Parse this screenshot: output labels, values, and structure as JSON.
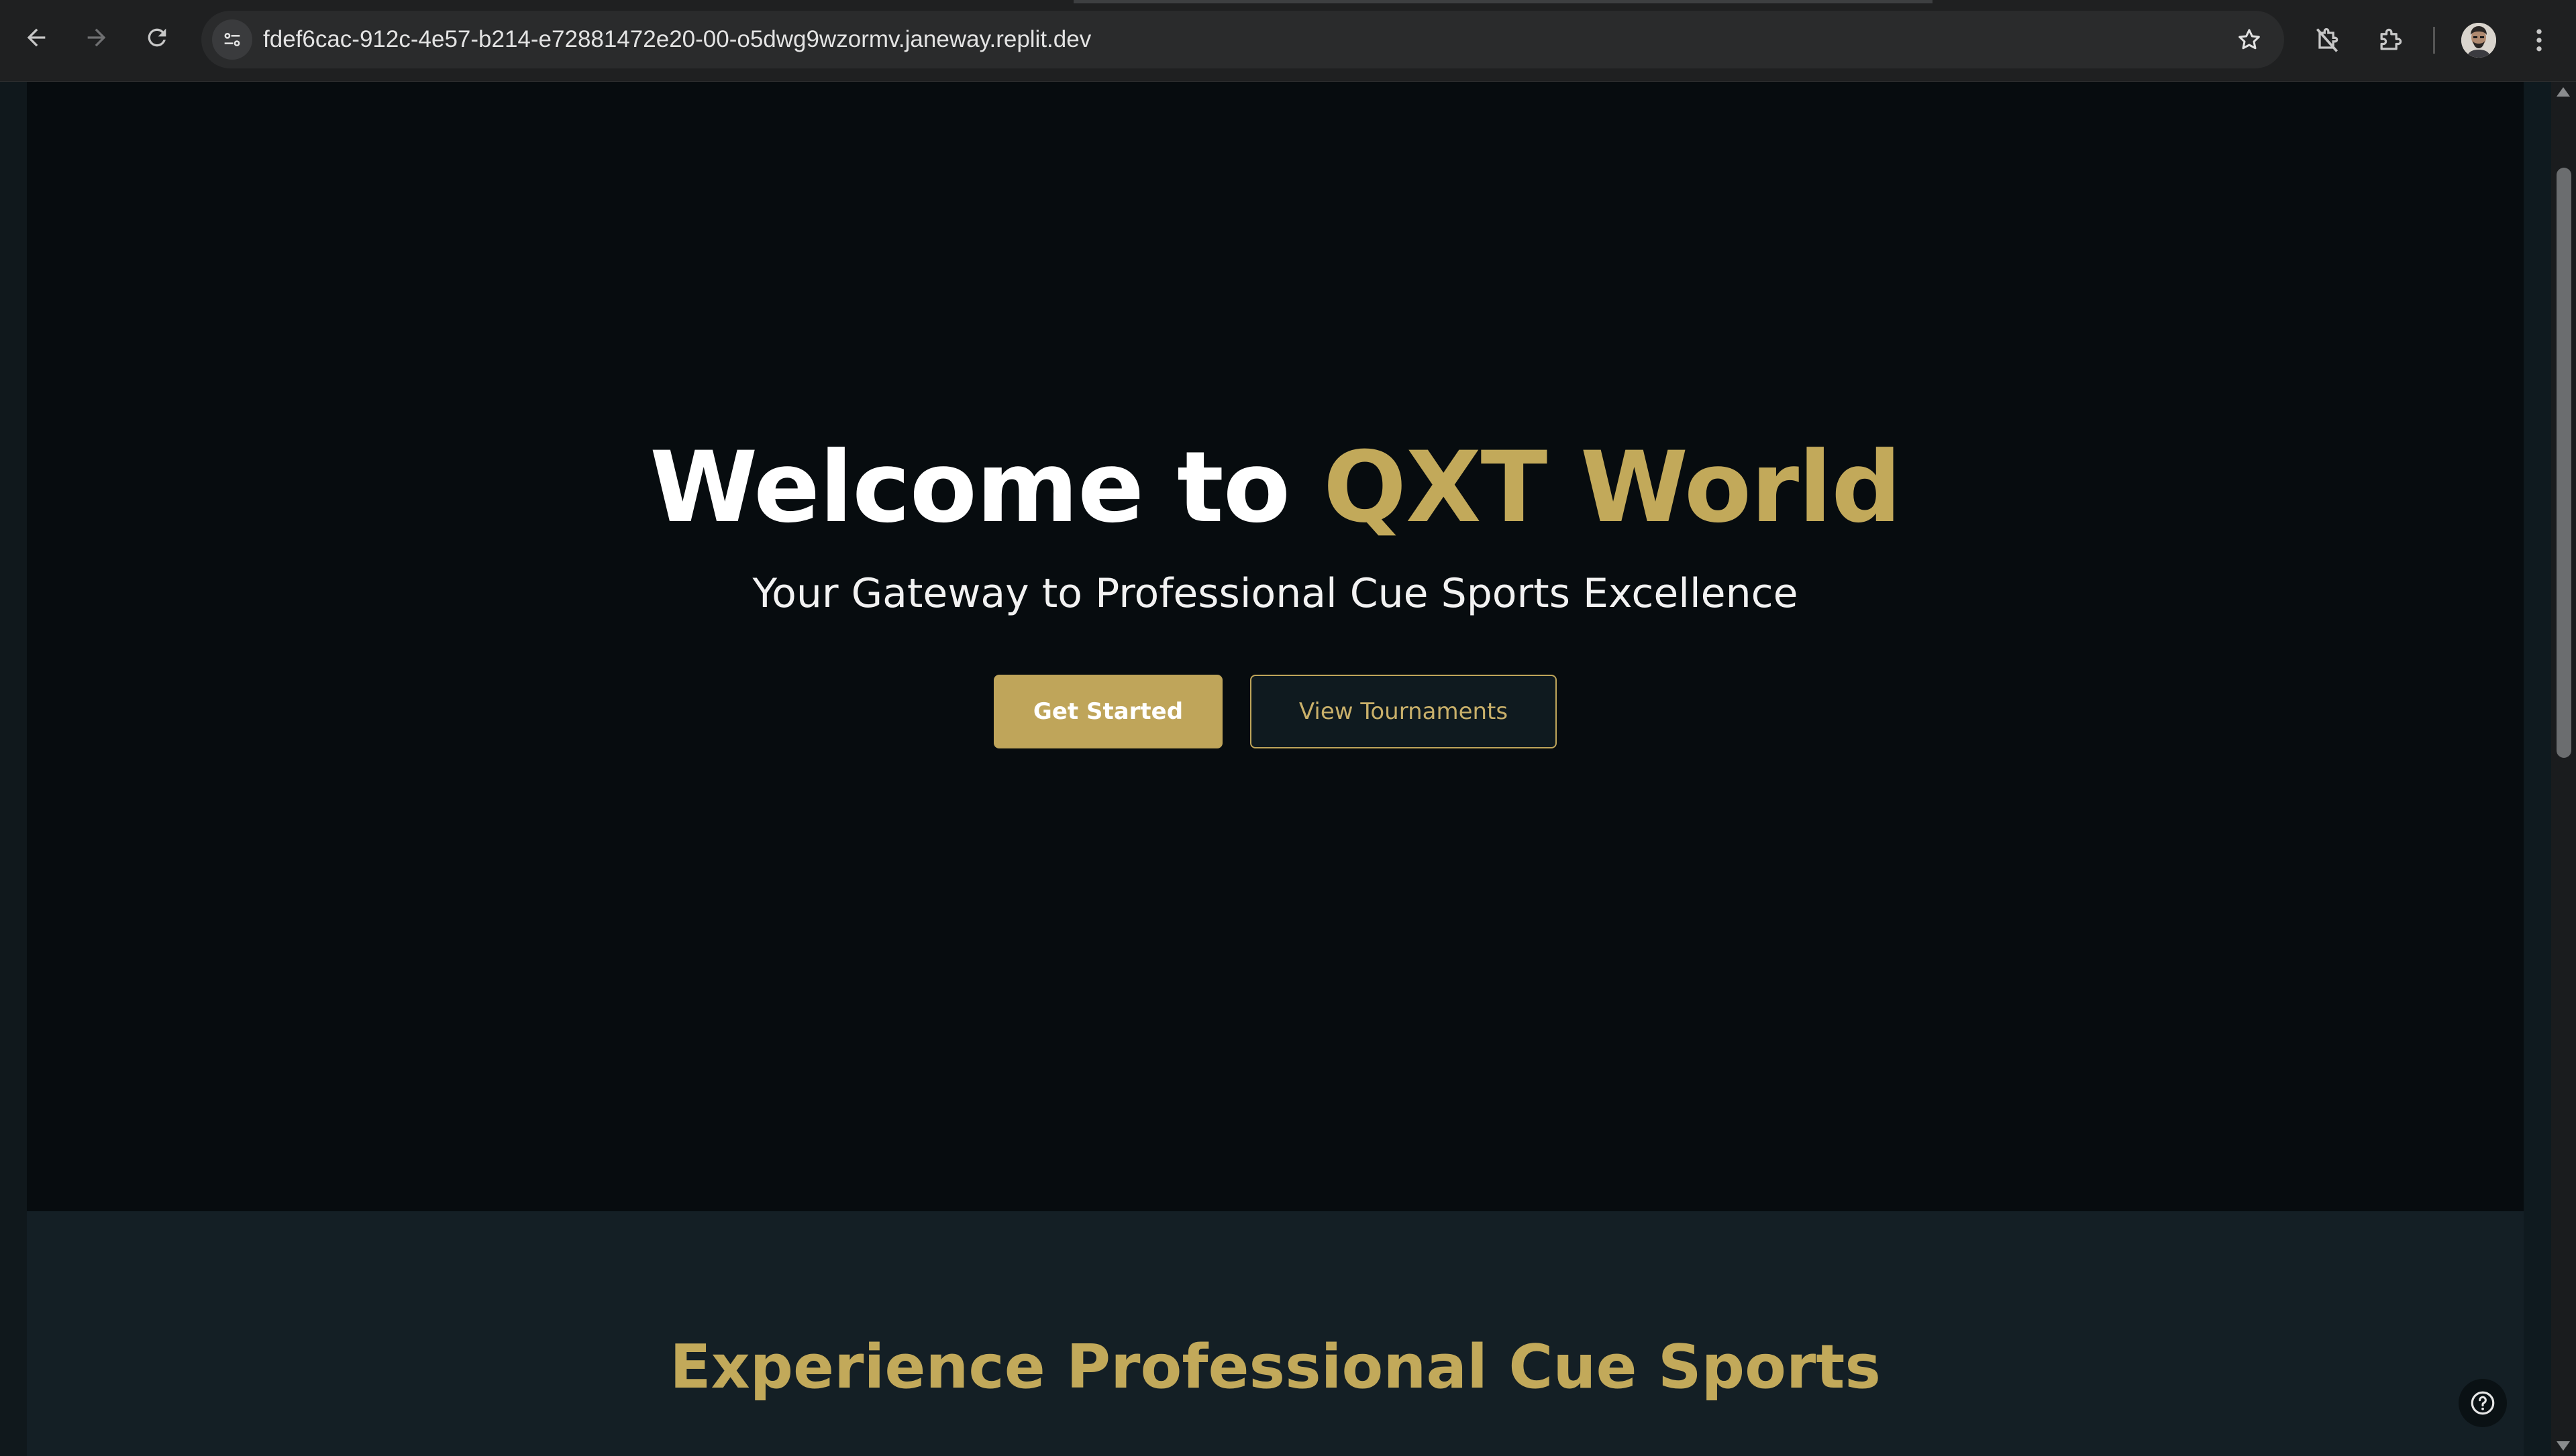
{
  "browser": {
    "url": "fdef6cac-912c-4e57-b214-e72881472e20-00-o5dwg9wzormv.janeway.replit.dev",
    "icons": {
      "back": "arrow-left-icon",
      "forward": "arrow-right-icon",
      "reload": "reload-icon",
      "site_info": "tune-icon",
      "bookmark": "star-icon",
      "extension_blocked": "extension-off-icon",
      "extensions": "puzzle-icon",
      "menu": "kebab-menu-icon"
    }
  },
  "hero": {
    "title_prefix": "Welcome to ",
    "title_accent": "QXT World",
    "subtitle": "Your Gateway to Professional Cue Sports Excellence",
    "primary_button": "Get Started",
    "secondary_button": "View Tournaments"
  },
  "features": {
    "heading": "Experience Professional Cue Sports"
  },
  "colors": {
    "accent_gold": "#c2a95a",
    "hero_background": "#070c0f",
    "section_background": "#141f25",
    "text_white": "#ffffff"
  }
}
